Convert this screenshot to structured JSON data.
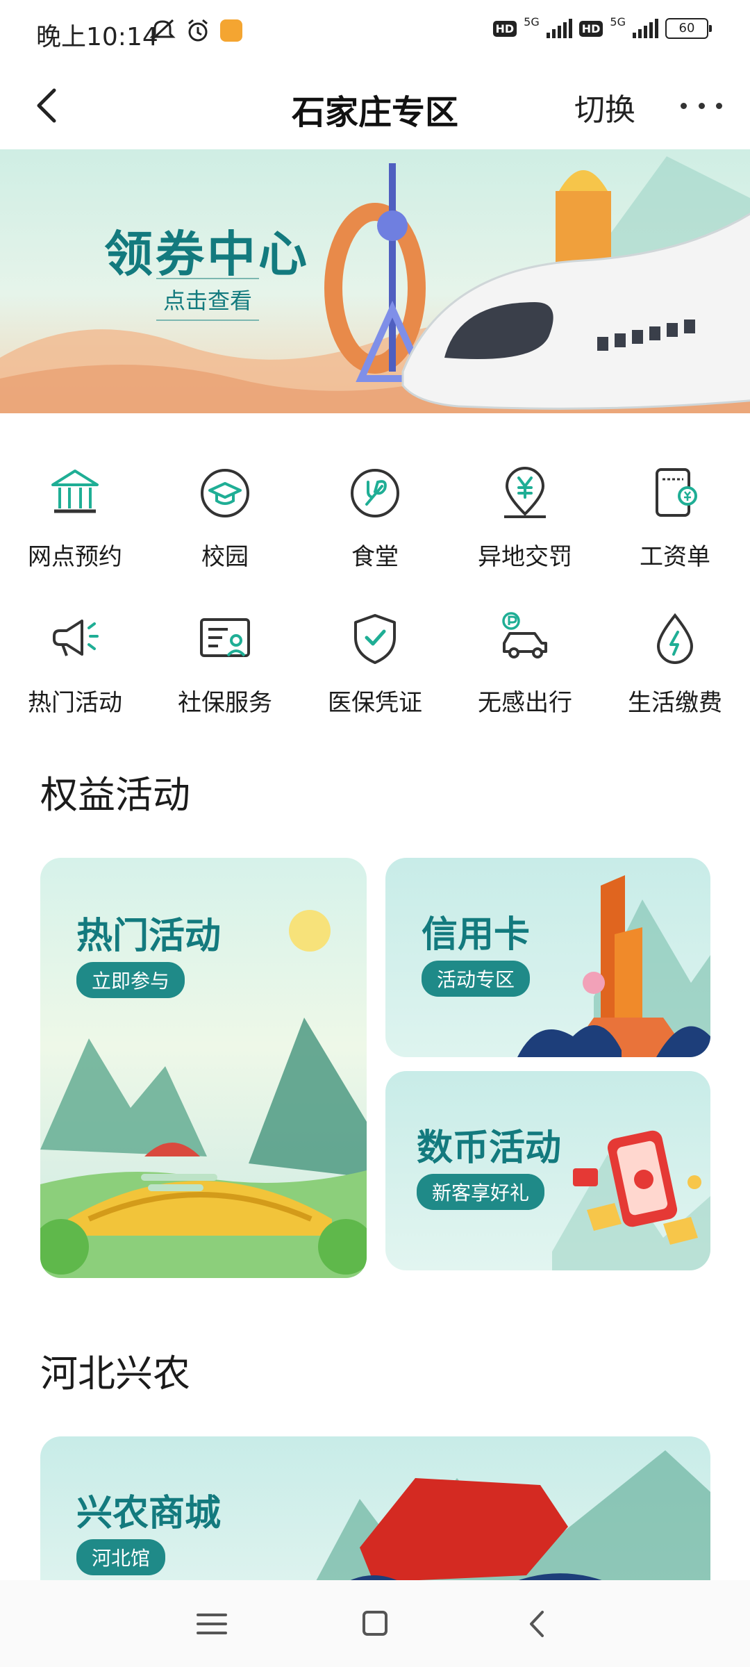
{
  "status_bar": {
    "time": "晚上10:14",
    "signal": "5G",
    "hd": "HD",
    "battery": "60"
  },
  "nav": {
    "title": "石家庄专区",
    "switch_label": "切换"
  },
  "banner": {
    "title": "领券中心",
    "subtitle": "点击查看"
  },
  "services": {
    "row1": [
      {
        "label": "网点预约",
        "icon": "bank-icon"
      },
      {
        "label": "校园",
        "icon": "graduation-cap-icon"
      },
      {
        "label": "食堂",
        "icon": "cutlery-icon"
      },
      {
        "label": "异地交罚",
        "icon": "yuan-location-icon"
      },
      {
        "label": "工资单",
        "icon": "salary-slip-icon"
      }
    ],
    "row2": [
      {
        "label": "热门活动",
        "icon": "megaphone-icon"
      },
      {
        "label": "社保服务",
        "icon": "id-card-icon"
      },
      {
        "label": "医保凭证",
        "icon": "shield-check-icon"
      },
      {
        "label": "无感出行",
        "icon": "car-parking-icon"
      },
      {
        "label": "生活缴费",
        "icon": "water-drop-bolt-icon"
      }
    ]
  },
  "benefits": {
    "title": "权益活动",
    "hot": {
      "title": "热门活动",
      "pill": "立即参与"
    },
    "credit": {
      "title": "信用卡",
      "pill": "活动专区"
    },
    "digital": {
      "title": "数币活动",
      "pill": "新客享好礼"
    }
  },
  "hebei": {
    "title": "河北兴农",
    "mall": {
      "title": "兴农商城",
      "pill": "河北馆"
    }
  },
  "colors": {
    "accent": "#137a7e",
    "icon": "#1fae95"
  }
}
